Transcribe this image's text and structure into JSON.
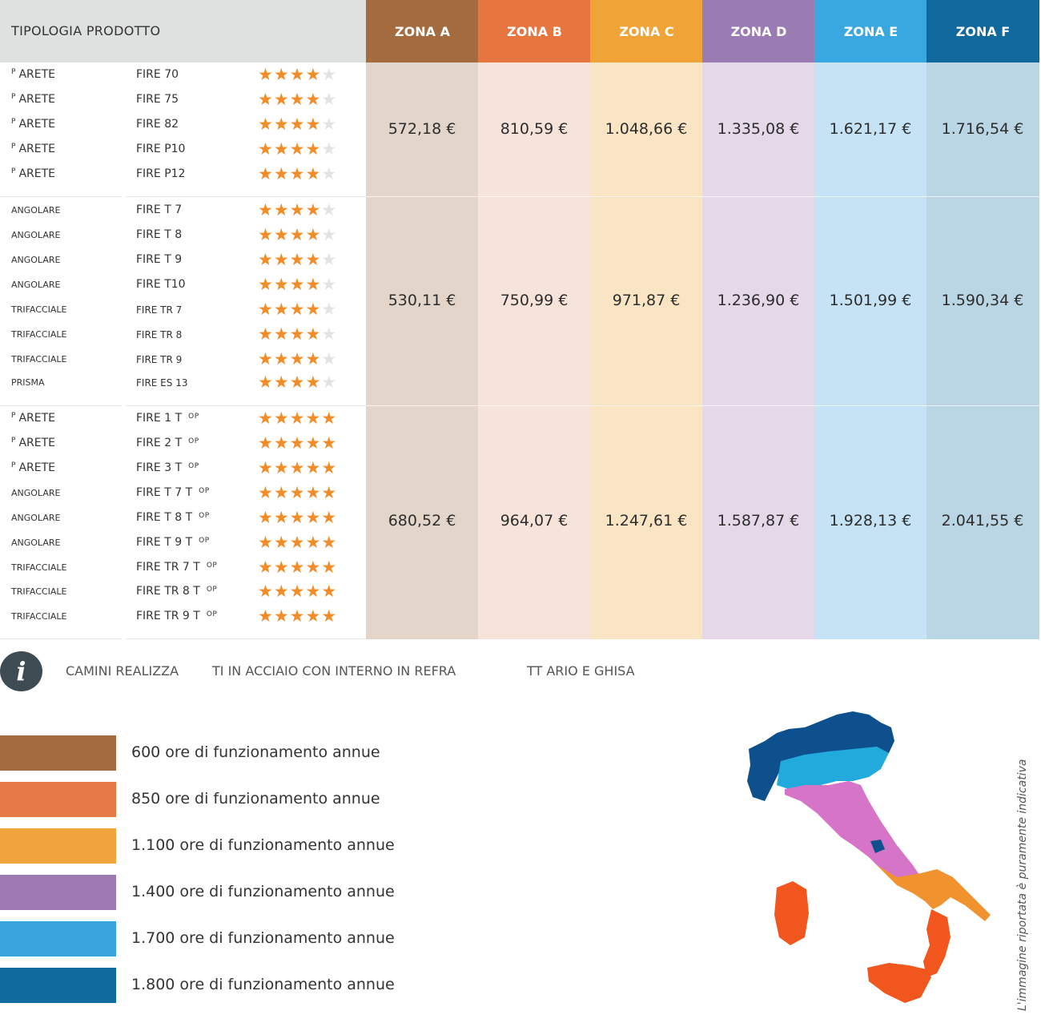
{
  "header": {
    "title": "TIPOLOGIA PRODOTTO",
    "zones": [
      {
        "label": "ZONA A",
        "head_color": "#a36b3e",
        "col_color": "#e3d5c9"
      },
      {
        "label": "ZONA B",
        "head_color": "#e7753f",
        "col_color": "#f6e3d9"
      },
      {
        "label": "ZONA C",
        "head_color": "#f0a437",
        "col_color": "#f9e4c4"
      },
      {
        "label": "ZONA D",
        "head_color": "#9b7bb3",
        "col_color": "#e5d8e9"
      },
      {
        "label": "ZONA E",
        "head_color": "#39a7e0",
        "col_color": "#c6e3f5"
      },
      {
        "label": "ZONA F",
        "head_color": "#11689c",
        "col_color": "#bad5e3"
      }
    ]
  },
  "groups": [
    {
      "rows": [
        {
          "type_prefix": "P",
          "type": "ARETE",
          "name": "FIRE 70",
          "suffix": "",
          "rating": 4
        },
        {
          "type_prefix": "P",
          "type": "ARETE",
          "name": "FIRE 75",
          "suffix": "",
          "rating": 4
        },
        {
          "type_prefix": "P",
          "type": "ARETE",
          "name": "FIRE 82",
          "suffix": "",
          "rating": 4
        },
        {
          "type_prefix": "P",
          "type": "ARETE",
          "name": "FIRE P10",
          "suffix": "",
          "rating": 4
        },
        {
          "type_prefix": "P",
          "type": "ARETE",
          "name": "FIRE P12",
          "suffix": "",
          "rating": 4
        }
      ],
      "prices": [
        "572,18 €",
        "810,59 €",
        "1.048,66 €",
        "1.335,08 €",
        "1.621,17 €",
        "1.716,54 €"
      ]
    },
    {
      "rows": [
        {
          "type_prefix": "",
          "type": "ANGOLARE",
          "name": "FIRE T 7",
          "suffix": "",
          "rating": 4
        },
        {
          "type_prefix": "",
          "type": "ANGOLARE",
          "name": "FIRE T 8",
          "suffix": "",
          "rating": 4
        },
        {
          "type_prefix": "",
          "type": "ANGOLARE",
          "name": "FIRE T 9",
          "suffix": "",
          "rating": 4
        },
        {
          "type_prefix": "",
          "type": "ANGOLARE",
          "name": "FIRE T10",
          "suffix": "",
          "rating": 4
        },
        {
          "type_prefix": "",
          "type": "TRIFACCIALE",
          "name": "FIRE TR 7",
          "suffix": "",
          "rating": 4
        },
        {
          "type_prefix": "",
          "type": "TRIFACCIALE",
          "name": "FIRE TR 8",
          "suffix": "",
          "rating": 4
        },
        {
          "type_prefix": "",
          "type": "TRIFACCIALE",
          "name": "FIRE TR 9",
          "suffix": "",
          "rating": 4
        },
        {
          "type_prefix": "",
          "type": "PRISMA",
          "name": "FIRE ES 13",
          "suffix": "",
          "rating": 4
        }
      ],
      "prices": [
        "530,11 €",
        "750,99 €",
        "971,87 €",
        "1.236,90 €",
        "1.501,99 €",
        "1.590,34 €"
      ]
    },
    {
      "rows": [
        {
          "type_prefix": "P",
          "type": "ARETE",
          "name": "FIRE 1 T",
          "suffix": "OP",
          "rating": 5
        },
        {
          "type_prefix": "P",
          "type": "ARETE",
          "name": "FIRE 2 T",
          "suffix": "OP",
          "rating": 5
        },
        {
          "type_prefix": "P",
          "type": "ARETE",
          "name": "FIRE 3 T",
          "suffix": "OP",
          "rating": 5
        },
        {
          "type_prefix": "",
          "type": "ANGOLARE",
          "name": "FIRE T 7 T",
          "suffix": "OP",
          "rating": 5
        },
        {
          "type_prefix": "",
          "type": "ANGOLARE",
          "name": "FIRE T 8 T",
          "suffix": "OP",
          "rating": 5
        },
        {
          "type_prefix": "",
          "type": "ANGOLARE",
          "name": "FIRE T 9 T",
          "suffix": "OP",
          "rating": 5
        },
        {
          "type_prefix": "",
          "type": "TRIFACCIALE",
          "name": "FIRE TR 7 T",
          "suffix": "OP",
          "rating": 5
        },
        {
          "type_prefix": "",
          "type": "TRIFACCIALE",
          "name": "FIRE TR 8 T",
          "suffix": "OP",
          "rating": 5
        },
        {
          "type_prefix": "",
          "type": "TRIFACCIALE",
          "name": "FIRE TR 9 T",
          "suffix": "OP",
          "rating": 5
        }
      ],
      "prices": [
        "680,52 €",
        "964,07 €",
        "1.247,61 €",
        "1.587,87 €",
        "1.928,13 €",
        "2.041,55 €"
      ]
    }
  ],
  "info": {
    "icon": "info-icon",
    "parts": [
      "CAMINI REALIZZA",
      "TI IN ACCIAIO CON INTERNO IN REFRA",
      "TT ARIO E GHISA"
    ]
  },
  "legend": [
    {
      "color": "#a36b3e",
      "text": "600 ore di funzionamento annue"
    },
    {
      "color": "#e57a46",
      "text": "850 ore di funzionamento annue"
    },
    {
      "color": "#f0a43b",
      "text": "1.100 ore di funzionamento annue"
    },
    {
      "color": "#9e7ab3",
      "text": "1.400 ore di funzionamento annue"
    },
    {
      "color": "#37a4dc",
      "text": "1.700 ore di funzionamento annue"
    },
    {
      "color": "#116a9d",
      "text": "1.800 ore di funzionamento annue"
    }
  ],
  "map": {
    "icon": "italy-map-icon"
  },
  "note": "L'immagine riportata è puramente indicativa"
}
